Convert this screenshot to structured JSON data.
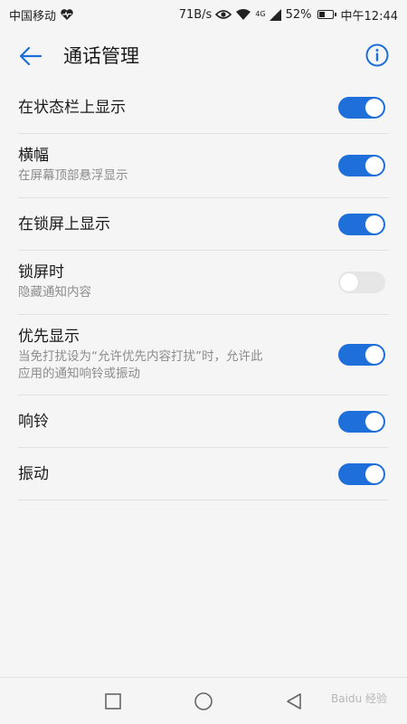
{
  "status_bar": {
    "carrier": "中国移动",
    "speed": "71B/s",
    "network_badge": "4G",
    "battery_percent": "52%",
    "battery_level": 0.52,
    "time": "中午12:44",
    "icons": [
      "heart-pulse-icon",
      "eye-icon",
      "wifi-icon",
      "signal-icon",
      "battery-icon"
    ]
  },
  "header": {
    "title": "通话管理",
    "back_icon": "arrow-left-icon",
    "info_icon": "info-circle-icon"
  },
  "settings": [
    {
      "title": "在状态栏上显示",
      "subtitle": "",
      "enabled": true
    },
    {
      "title": "横幅",
      "subtitle": "在屏幕顶部悬浮显示",
      "enabled": true
    },
    {
      "title": "在锁屏上显示",
      "subtitle": "",
      "enabled": true
    },
    {
      "title": "锁屏时",
      "subtitle": "隐藏通知内容",
      "enabled": false
    },
    {
      "title": "优先显示",
      "subtitle_lines": [
        "当免打扰设为“允许优先内容打扰”时，允许此",
        "应用的通知响铃或振动"
      ],
      "enabled": true
    },
    {
      "title": "响铃",
      "subtitle": "",
      "enabled": true
    },
    {
      "title": "振动",
      "subtitle": "",
      "enabled": true
    }
  ],
  "nav_bar": {
    "icons": [
      "square-recents-icon",
      "circle-home-icon",
      "triangle-back-icon"
    ]
  },
  "watermark": "Baidu 经验",
  "colors": {
    "accent": "#1e6fd9",
    "toggle_off": "#e6e6e6",
    "background": "#f5f5f5"
  }
}
